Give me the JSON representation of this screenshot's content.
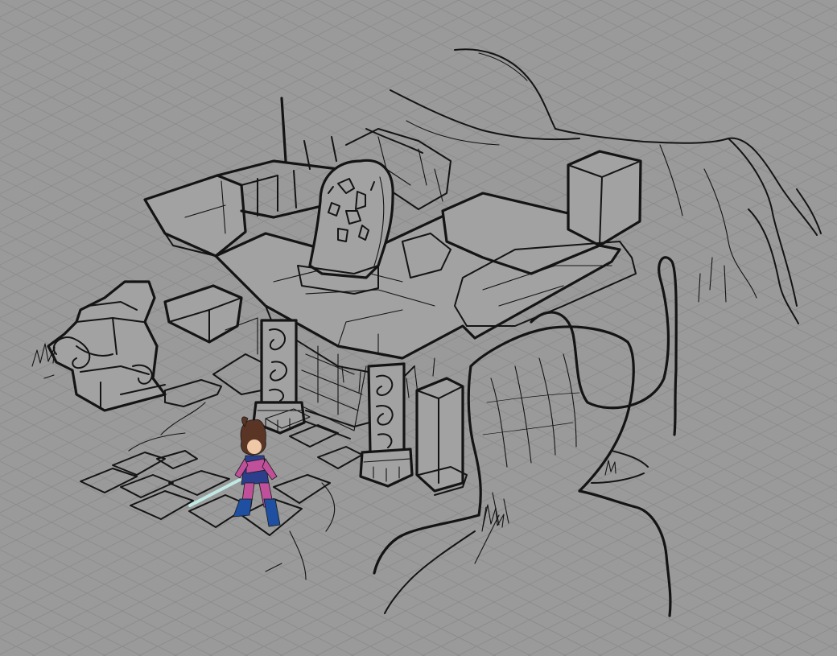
{
  "scene": {
    "type": "isometric-concept-sketch",
    "background_color": "#9a9a9a",
    "grid_color": "#8c8c8c",
    "line_color": "#141414",
    "grid": "isometric",
    "objects": [
      "ruined-stone-shrine",
      "spiral-carved-pillar",
      "carved-rune-stone",
      "stone-guardian-statue",
      "gnarled-tree-roots",
      "cracked-floor-tiles",
      "player-character"
    ]
  },
  "character": {
    "hair_color": "#5a3424",
    "outfit_primary": "#2c3f8c",
    "outfit_accent": "#c0509a",
    "boots_color": "#1f4fa0",
    "sword_color": "#bfe9e4"
  }
}
